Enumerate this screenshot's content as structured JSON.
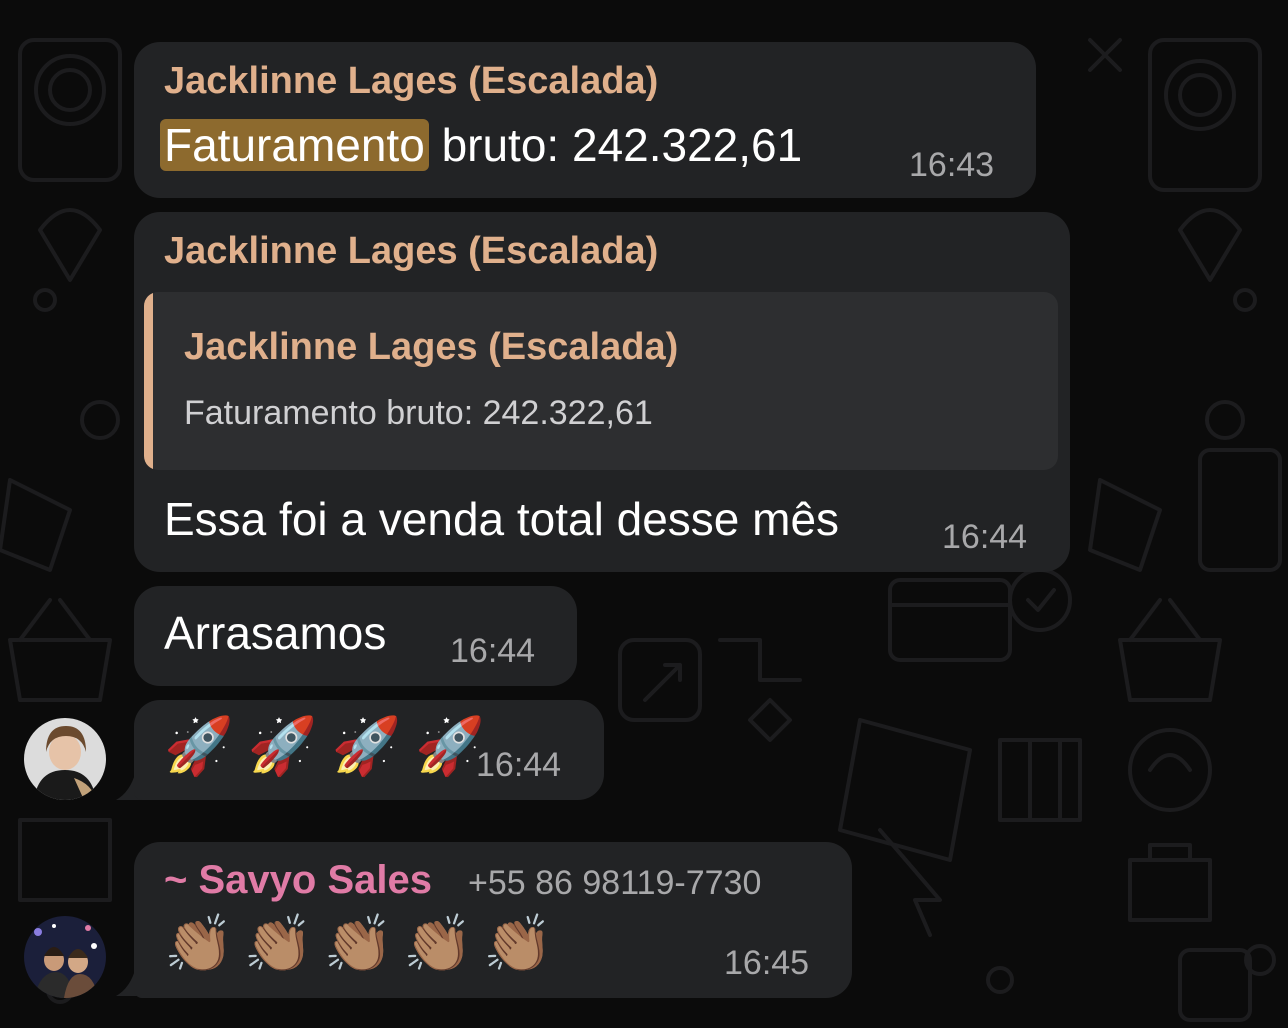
{
  "messages": [
    {
      "sender": "Jacklinne Lages (Escalada)",
      "text_highlight": "Faturamento",
      "text_rest": " bruto: 242.322,61",
      "time": "16:43"
    },
    {
      "sender": "Jacklinne Lages (Escalada)",
      "quote_sender": "Jacklinne Lages (Escalada)",
      "quote_text": "Faturamento bruto: 242.322,61",
      "text": "Essa foi a venda total desse mês",
      "time": "16:44"
    },
    {
      "text": "Arrasamos",
      "time": "16:44"
    },
    {
      "emoji": [
        "🚀",
        "🚀",
        "🚀",
        "🚀"
      ],
      "time": "16:44"
    },
    {
      "sender": "~ Savyo Sales",
      "phone": "+55 86 98119-7730",
      "emoji": [
        "👏🏽",
        "👏🏽",
        "👏🏽",
        "👏🏽",
        "👏🏽"
      ],
      "time": "16:45"
    }
  ],
  "colors": {
    "background": "#0b0b0b",
    "bubble": "#222325",
    "sender_name": "#e0b08c",
    "sender_pink": "#e07ba6",
    "search_highlight": "#8d6a2e",
    "timestamp": "#a8a8aa"
  }
}
